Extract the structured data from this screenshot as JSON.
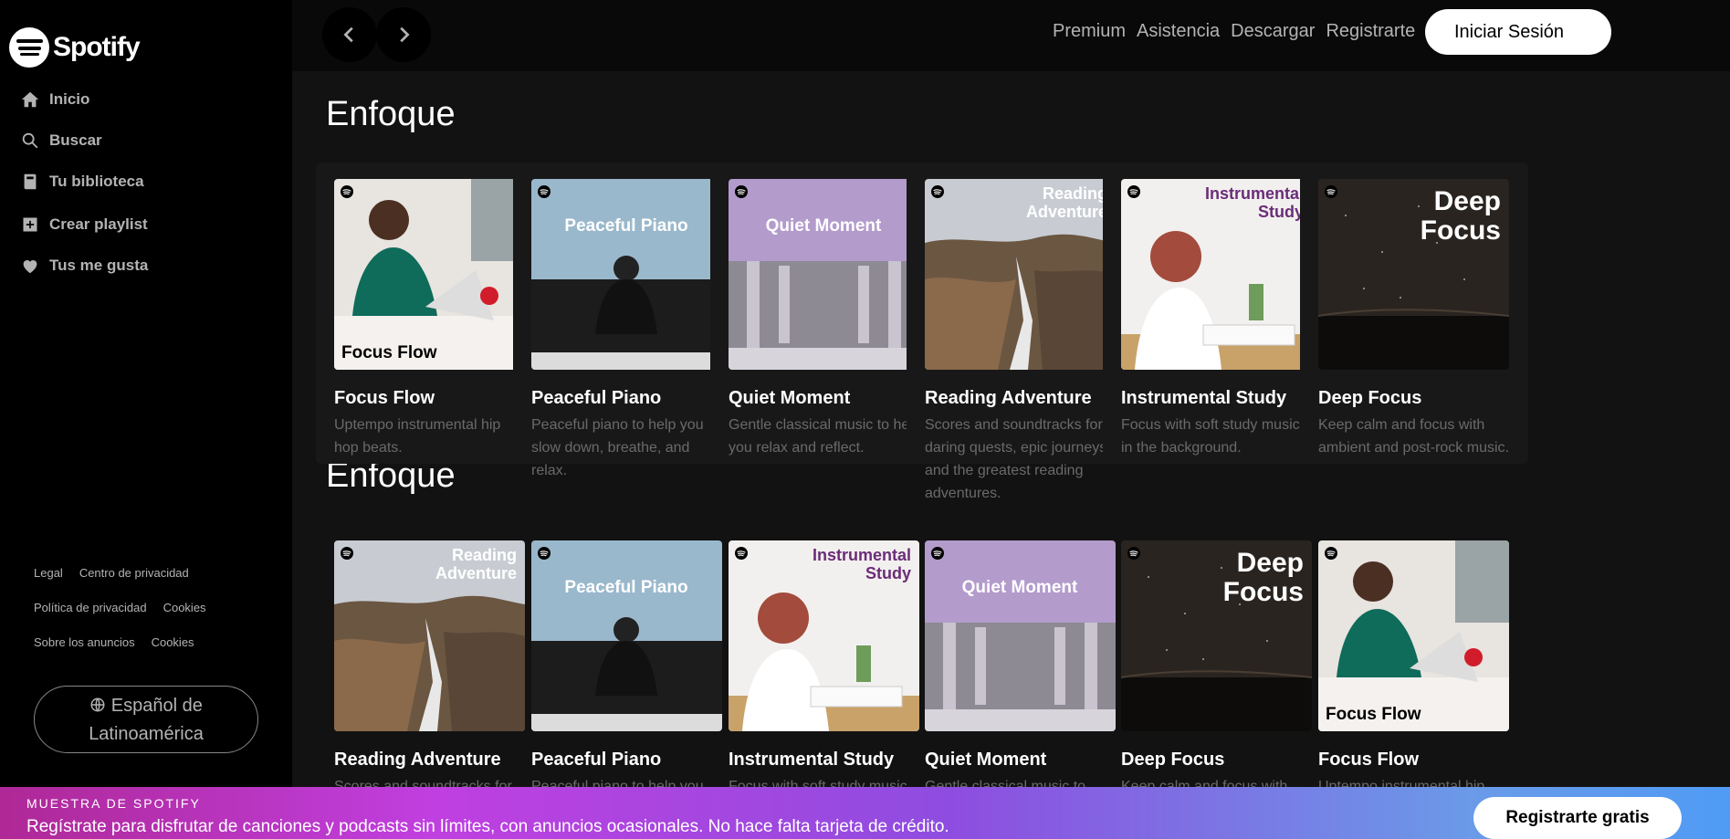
{
  "brand": {
    "name": "Spotify",
    "accent": "#1db954"
  },
  "sidebar": {
    "nav": [
      {
        "label": "Inicio",
        "icon": "home-icon"
      },
      {
        "label": "Buscar",
        "icon": "search-icon"
      },
      {
        "label": "Tu biblioteca",
        "icon": "library-icon"
      }
    ],
    "actions": [
      {
        "label": "Crear playlist",
        "icon": "plus-square-icon"
      },
      {
        "label": "Tus me gusta",
        "icon": "heart-icon"
      }
    ],
    "legal": [
      [
        "Legal",
        "Centro de privacidad"
      ],
      [
        "Política de privacidad",
        "Cookies"
      ],
      [
        "Sobre los anuncios",
        "Cookies"
      ]
    ],
    "language_line1": "Español de",
    "language_line2": "Latinoamérica"
  },
  "topbar": {
    "links": [
      "Premium",
      "Asistencia",
      "Descargar",
      "Registrarte"
    ],
    "login": "Iniciar Sesión"
  },
  "sections": [
    {
      "title": "Enfoque",
      "cards": [
        {
          "title": "Focus Flow",
          "desc": "Uptempo instrumental hip hop beats.",
          "cover_text": "Focus Flow"
        },
        {
          "title": "Peaceful Piano",
          "desc": "Peaceful piano to help you slow down, breathe, and relax.",
          "cover_text": "Peaceful Piano"
        },
        {
          "title": "Quiet Moment",
          "desc": "Gentle classical music to help you relax and reflect.",
          "cover_text": "Quiet Moment"
        },
        {
          "title": "Reading Adventure",
          "desc": "Scores and soundtracks for daring quests, epic journeys, and the greatest reading adventures.",
          "cover_text": "Reading Adventure"
        },
        {
          "title": "Instrumental Study",
          "desc": "Focus with soft study music in the background.",
          "cover_text": "Instrumental Study"
        },
        {
          "title": "Deep Focus",
          "desc": "Keep calm and focus with ambient and post-rock music.",
          "cover_text": "Deep Focus"
        }
      ]
    },
    {
      "title": "Enfoque",
      "cards": [
        {
          "title": "Reading Adventure",
          "desc": "Scores and soundtracks for",
          "cover_text": "Reading Adventure"
        },
        {
          "title": "Peaceful Piano",
          "desc": "Peaceful piano to help you",
          "cover_text": "Peaceful Piano"
        },
        {
          "title": "Instrumental Study",
          "desc": "Focus with soft study music",
          "cover_text": "Instrumental Study"
        },
        {
          "title": "Quiet Moment",
          "desc": "Gentle classical music to",
          "cover_text": "Quiet Moment"
        },
        {
          "title": "Deep Focus",
          "desc": "Keep calm and focus with",
          "cover_text": "Deep Focus"
        },
        {
          "title": "Focus Flow",
          "desc": "Uptempo instrumental hip",
          "cover_text": "Focus Flow"
        }
      ]
    }
  ],
  "banner": {
    "label": "MUESTRA DE SPOTIFY",
    "text": "Regístrate para disfrutar de canciones y podcasts sin límites, con anuncios ocasionales. No hace falta tarjeta de crédito.",
    "cta": "Registrarte gratis"
  }
}
